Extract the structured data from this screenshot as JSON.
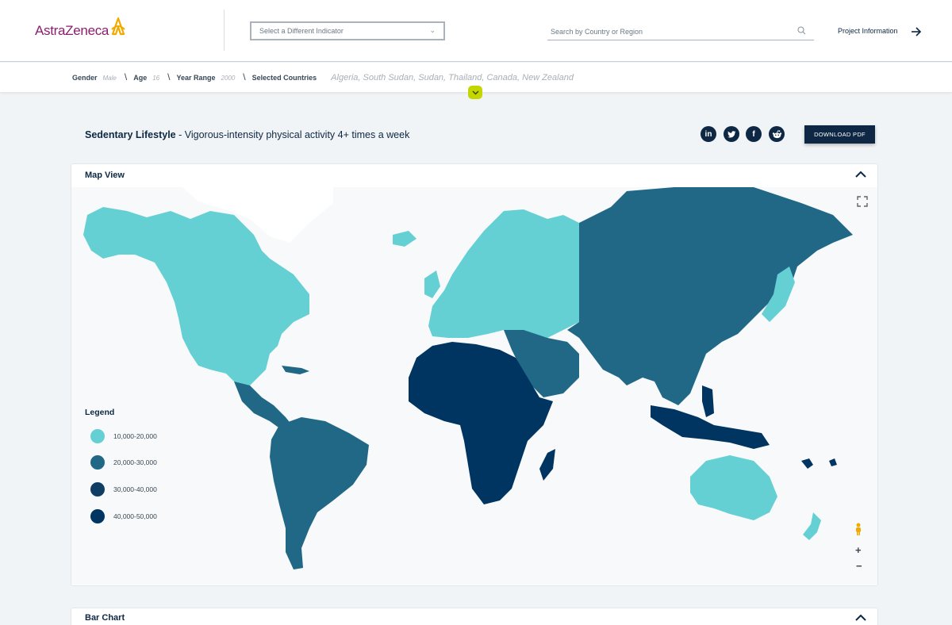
{
  "header": {
    "logo_text": "AstraZeneca",
    "indicator_placeholder": "Select a Different Indicator",
    "search_placeholder": "Search by Country or Region",
    "project_info": "Project Information"
  },
  "filters": {
    "gender_label": "Gender",
    "gender_value": "Male",
    "age_label": "Age",
    "age_value": "16",
    "year_label": "Year Range",
    "year_value": "2000",
    "countries_label": "Selected Countries",
    "countries_value": "Algeria, South Sudan, Sudan, Thailand, Canada, New Zealand"
  },
  "indicator": {
    "name": "Sedentary Lifestyle",
    "description": " - Vigorous-intensity physical activity 4+ times a week"
  },
  "social": [
    "linkedin-icon",
    "twitter-icon",
    "facebook-icon",
    "reddit-icon"
  ],
  "download_label": "DOWNLOAD PDF",
  "map_card": {
    "title": "Map View",
    "legend_title": "Legend",
    "legend": [
      {
        "label": "10,000-20,000",
        "color": "#65d0d4"
      },
      {
        "label": "20,000-30,000",
        "color": "#216786"
      },
      {
        "label": "30,000-40,000",
        "color": "#0f3d64"
      },
      {
        "label": "40,000-50,000",
        "color": "#003561"
      }
    ]
  },
  "bar_card": {
    "title": "Bar Chart"
  },
  "colors": {
    "navy": "#0d2744",
    "accent": "#c4d600",
    "brand": "#8b1e6f"
  }
}
